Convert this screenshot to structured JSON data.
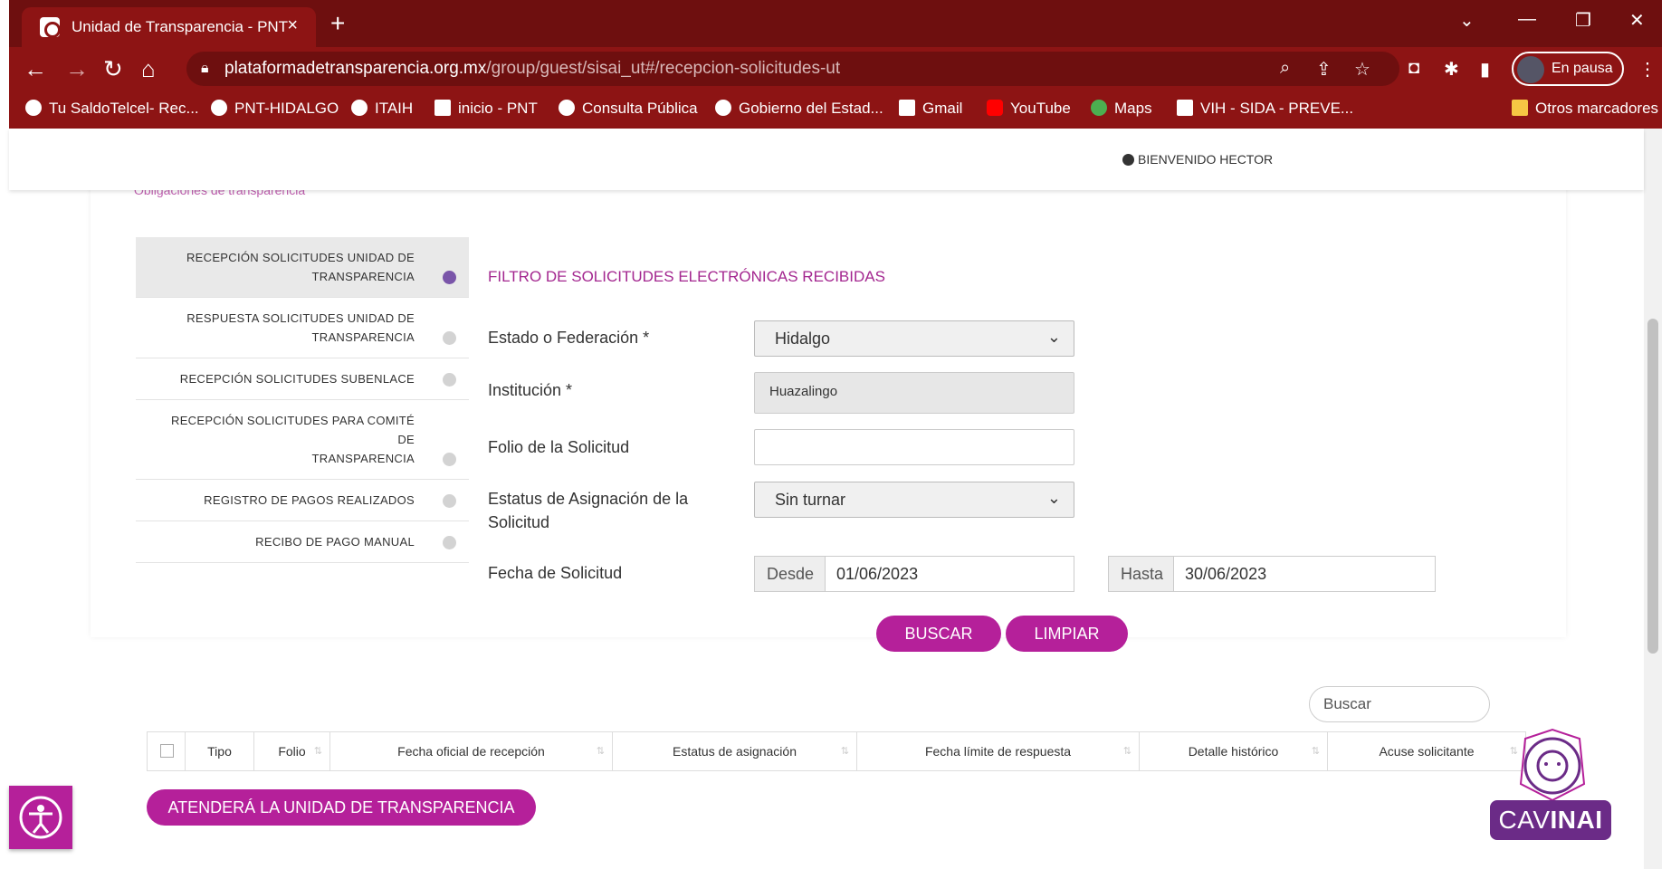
{
  "browser": {
    "tab_title": "Unidad de Transparencia - PNT",
    "url_host": "plataformadetransparencia.org.mx",
    "url_path": "/group/guest/sisai_ut#/recepcion-solicitudes-ut",
    "profile_label": "En pausa",
    "bookmarks": [
      "Tu SaldoTelcel- Rec...",
      "PNT-HIDALGO",
      "ITAIH",
      "inicio - PNT",
      "Consulta Pública",
      "Gobierno del Estad...",
      "Gmail",
      "YouTube",
      "Maps",
      "VIH - SIDA - PREVE..."
    ],
    "other_bookmarks": "Otros marcadores"
  },
  "header": {
    "welcome": "BIENVENIDO HECTOR",
    "cut_link": "Obligaciones de transparencia"
  },
  "menu": {
    "items": [
      {
        "line1": "RECEPCIÓN SOLICITUDES UNIDAD DE",
        "line2": "TRANSPARENCIA"
      },
      {
        "line1": "RESPUESTA SOLICITUDES UNIDAD DE",
        "line2": "TRANSPARENCIA"
      },
      {
        "line1": "RECEPCIÓN SOLICITUDES SUBENLACE",
        "line2": ""
      },
      {
        "line1": "RECEPCIÓN SOLICITUDES PARA COMITÉ DE",
        "line2": "TRANSPARENCIA"
      },
      {
        "line1": "REGISTRO DE PAGOS REALIZADOS",
        "line2": ""
      },
      {
        "line1": "RECIBO DE PAGO MANUAL",
        "line2": ""
      }
    ]
  },
  "form": {
    "title": "FILTRO DE SOLICITUDES ELECTRÓNICAS RECIBIDAS",
    "estado_label": "Estado o Federación *",
    "estado_value": "Hidalgo",
    "institucion_label": "Institución *",
    "institucion_value": "Huazalingo",
    "folio_label": "Folio de la Solicitud",
    "folio_value": "",
    "estatus_label_1": "Estatus de Asignación de la",
    "estatus_label_2": "Solicitud",
    "estatus_value": "Sin turnar",
    "fecha_label": "Fecha de Solicitud",
    "desde_label": "Desde",
    "desde_value": "01/06/2023",
    "hasta_label": "Hasta",
    "hasta_value": "30/06/2023",
    "buscar_button": "BUSCAR",
    "limpiar_button": "LIMPIAR"
  },
  "table": {
    "search_placeholder": "Buscar",
    "columns": [
      "Tipo",
      "Folio",
      "Fecha oficial de recepción",
      "Estatus de asignación",
      "Fecha límite de respuesta",
      "Detalle histórico",
      "Acuse solicitante"
    ]
  },
  "footer": {
    "attend_button": "ATENDERÁ LA UNIDAD DE TRANSPARENCIA",
    "cavinai_left": "CAV",
    "cavinai_right": "INAI"
  },
  "colors": {
    "browser_dark": "#6e0f0f",
    "browser_bar": "#8d1414",
    "accent": "#b5209a",
    "title_color": "#a3268f",
    "active_dot": "#7a55a9"
  }
}
